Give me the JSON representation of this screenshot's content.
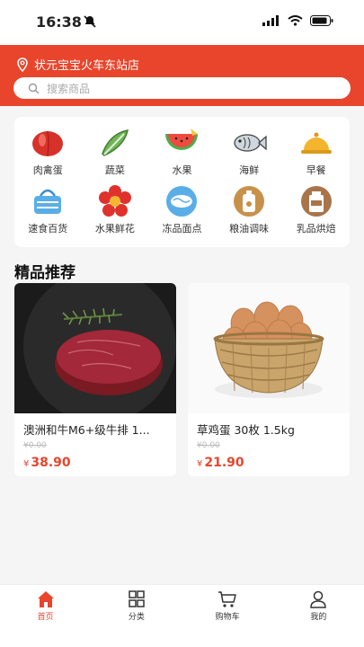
{
  "status": {
    "time": "16:38"
  },
  "header": {
    "location": "状元宝宝火车东站店",
    "search_placeholder": "搜索商品"
  },
  "categories": [
    {
      "label": "肉禽蛋",
      "icon": "meat-icon"
    },
    {
      "label": "蔬菜",
      "icon": "vegetable-icon"
    },
    {
      "label": "水果",
      "icon": "watermelon-icon"
    },
    {
      "label": "海鲜",
      "icon": "fish-icon"
    },
    {
      "label": "早餐",
      "icon": "breakfast-icon"
    },
    {
      "label": "速食百货",
      "icon": "basket-icon"
    },
    {
      "label": "水果鲜花",
      "icon": "flower-icon"
    },
    {
      "label": "冻品面点",
      "icon": "frozen-icon"
    },
    {
      "label": "粮油调味",
      "icon": "oil-icon"
    },
    {
      "label": "乳品烘焙",
      "icon": "dairy-icon"
    }
  ],
  "section": {
    "title": "精品推荐"
  },
  "products": [
    {
      "name": "澳洲和牛M6+级牛排 1...",
      "old_price": "¥0.00",
      "currency": "¥",
      "price": "38.90"
    },
    {
      "name": "草鸡蛋 30枚 1.5kg",
      "old_price": "¥0.00",
      "currency": "¥",
      "price": "21.90"
    }
  ],
  "tabbar": [
    {
      "label": "首页",
      "icon": "home-icon",
      "active": true
    },
    {
      "label": "分类",
      "icon": "category-icon",
      "active": false
    },
    {
      "label": "购物车",
      "icon": "cart-icon",
      "active": false
    },
    {
      "label": "我的",
      "icon": "user-icon",
      "active": false
    }
  ],
  "colors": {
    "accent": "#e8452c",
    "background": "#f5f5f5"
  }
}
